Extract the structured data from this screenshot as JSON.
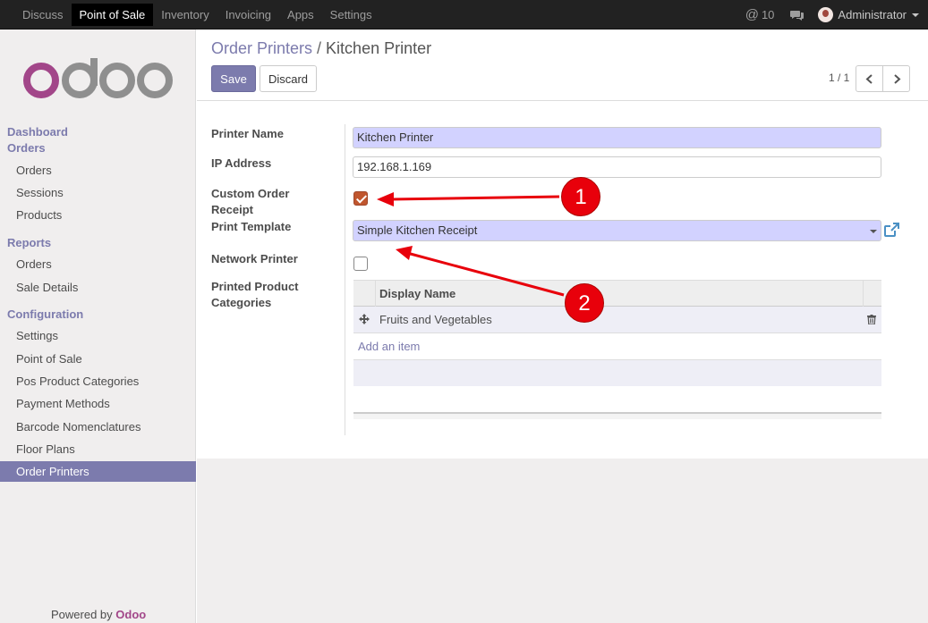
{
  "topbar": {
    "menu": [
      "Discuss",
      "Point of Sale",
      "Inventory",
      "Invoicing",
      "Apps",
      "Settings"
    ],
    "active_menu": "Point of Sale",
    "message_count": "10",
    "user_name": "Administrator"
  },
  "sidebar": {
    "sections": [
      {
        "title": "Dashboard"
      },
      {
        "title": "Orders",
        "items": [
          "Orders",
          "Sessions",
          "Products"
        ]
      },
      {
        "title": "Reports",
        "items": [
          "Orders",
          "Sale Details"
        ]
      },
      {
        "title": "Configuration",
        "items": [
          "Settings",
          "Point of Sale",
          "Pos Product Categories",
          "Payment Methods",
          "Barcode Nomenclatures",
          "Floor Plans",
          "Order Printers"
        ]
      }
    ],
    "active_item": "Order Printers",
    "powered_by": "Powered by",
    "powered_brand": "Odoo"
  },
  "control_panel": {
    "breadcrumb_parent": "Order Printers",
    "breadcrumb_sep": "/",
    "breadcrumb_current": "Kitchen Printer",
    "save_label": "Save",
    "discard_label": "Discard",
    "pager": "1 / 1"
  },
  "form": {
    "printer_name_label": "Printer Name",
    "printer_name": "Kitchen Printer",
    "ip_address_label": "IP Address",
    "ip_address": "192.168.1.169",
    "custom_receipt_label_1": "Custom Order",
    "custom_receipt_label_2": "Receipt",
    "custom_receipt_checked": true,
    "print_template_label": "Print Template",
    "print_template": "Simple Kitchen Receipt",
    "network_printer_label": "Network Printer",
    "network_printer_checked": false,
    "categories_label_1": "Printed Product",
    "categories_label_2": "Categories",
    "categories_table": {
      "column": "Display Name",
      "rows": [
        "Fruits and Vegetables"
      ],
      "add_item": "Add an item"
    }
  },
  "annotations": {
    "badge_1": "1",
    "badge_2": "2"
  },
  "colors": {
    "accent": "#7c7bad",
    "checkbox_checked": "#c0562e",
    "annotation_red": "#e8000b"
  }
}
